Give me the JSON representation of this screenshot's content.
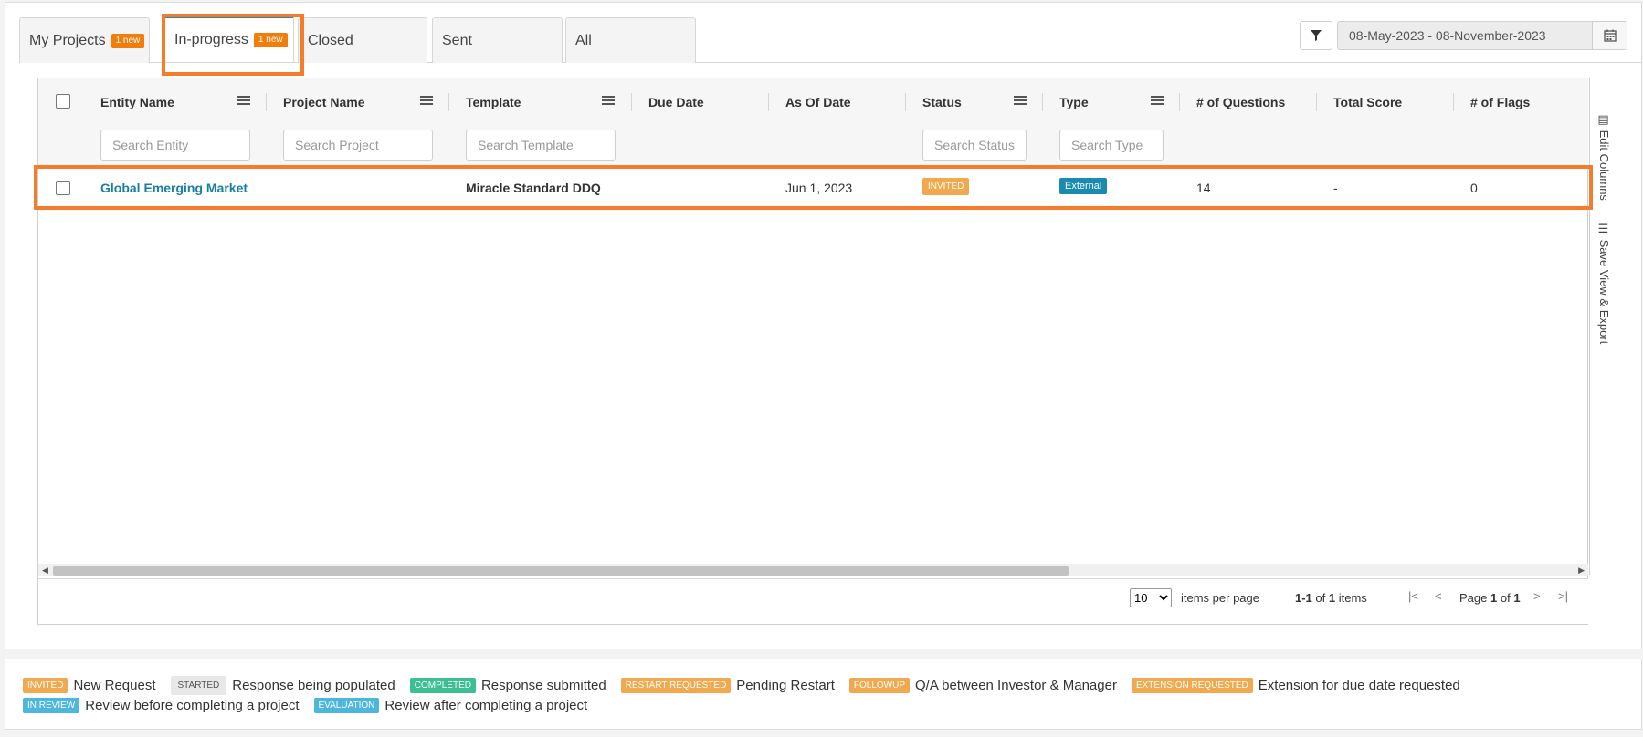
{
  "tabs": [
    {
      "label": "My Projects",
      "badge": "1 new"
    },
    {
      "label": "In-progress",
      "badge": "1 new"
    },
    {
      "label": "Closed"
    },
    {
      "label": "Sent"
    },
    {
      "label": "All"
    }
  ],
  "date_range": "08-May-2023 - 08-November-2023",
  "columns": [
    {
      "title": "Entity Name",
      "placeholder": "Search Entity"
    },
    {
      "title": "Project Name",
      "placeholder": "Search Project"
    },
    {
      "title": "Template",
      "placeholder": "Search Template"
    },
    {
      "title": "Due Date"
    },
    {
      "title": "As Of Date"
    },
    {
      "title": "Status",
      "placeholder": "Search Status"
    },
    {
      "title": "Type",
      "placeholder": "Search Type"
    },
    {
      "title": "# of Questions"
    },
    {
      "title": "Total Score"
    },
    {
      "title": "# of Flags"
    }
  ],
  "rows": [
    {
      "entity": "Global Emerging Market",
      "project": "",
      "template": "Miracle Standard DDQ",
      "due_date": "",
      "as_of_date": "Jun 1, 2023",
      "status": "INVITED",
      "type": "External",
      "questions": "14",
      "total_score": "-",
      "flags": "0"
    }
  ],
  "side_panel": {
    "edit_columns": "Edit Columns",
    "save_view": "Save View & Export"
  },
  "pager": {
    "page_size": "10",
    "items_per_page": "items per page",
    "range": "1-1",
    "of_word": "of",
    "total": "1",
    "items_word": "items",
    "page_word": "Page",
    "page": "1",
    "pages": "1"
  },
  "legend": [
    {
      "badge": "INVITED",
      "text": "New Request",
      "color": "#f0a94e"
    },
    {
      "badge": "STARTED",
      "text": "Response being populated",
      "color": "#e8e8e8"
    },
    {
      "badge": "COMPLETED",
      "text": "Response submitted",
      "color": "#3cbf93"
    },
    {
      "badge": "RESTART REQUESTED",
      "text": "Pending Restart",
      "color": "#f0a94e"
    },
    {
      "badge": "FOLLOWUP",
      "text": "Q/A between Investor & Manager",
      "color": "#f0a94e"
    },
    {
      "badge": "EXTENSION REQUESTED",
      "text": "Extension for due date requested",
      "color": "#f0a94e"
    },
    {
      "badge": "IN REVIEW",
      "text": "Review before completing a project",
      "color": "#4cb6dd"
    },
    {
      "badge": "EVALUATION",
      "text": "Review after completing a project",
      "color": "#4cb6dd"
    }
  ]
}
